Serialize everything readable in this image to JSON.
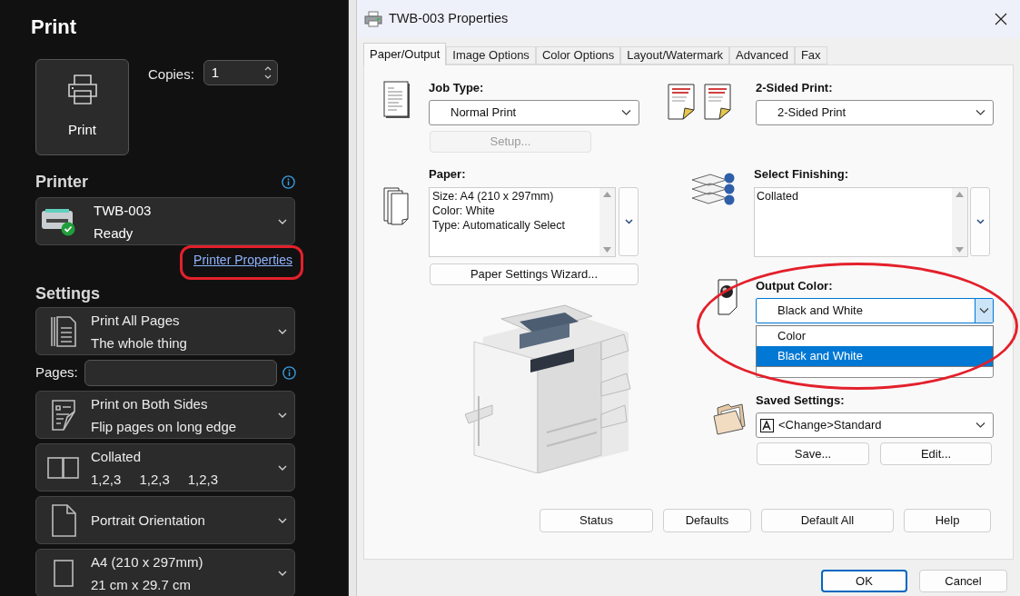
{
  "print_pane": {
    "title": "Print",
    "print_button": "Print",
    "copies": {
      "label": "Copies:",
      "value": "1"
    },
    "printer": {
      "heading": "Printer",
      "name": "TWB-003",
      "status": "Ready",
      "properties_link": "Printer Properties"
    },
    "settings": {
      "heading": "Settings",
      "items": [
        {
          "kind": "dropdown",
          "primary": "Print All Pages",
          "secondary": [
            "The whole thing"
          ]
        },
        {
          "kind": "field",
          "label": "Pages:"
        },
        {
          "kind": "dropdown",
          "primary": "Print on Both Sides",
          "secondary": [
            "Flip pages on long edge"
          ]
        },
        {
          "kind": "dropdown",
          "primary": "Collated",
          "secondary": [
            "1,2,3",
            "1,2,3",
            "1,2,3"
          ]
        },
        {
          "kind": "dropdown",
          "primary": "Portrait Orientation"
        },
        {
          "kind": "dropdown",
          "primary": "A4 (210 x 297mm)",
          "secondary": [
            "21 cm x 29.7 cm"
          ]
        }
      ]
    }
  },
  "dialog": {
    "title": "TWB-003 Properties",
    "tabs": [
      {
        "label": "Paper/Output",
        "selected": true
      },
      {
        "label": "Image Options",
        "selected": false
      },
      {
        "label": "Color Options",
        "selected": false
      },
      {
        "label": "Layout/Watermark",
        "selected": false
      },
      {
        "label": "Advanced",
        "selected": false
      },
      {
        "label": "Fax",
        "selected": false
      }
    ],
    "job_type": {
      "label": "Job Type:",
      "value": "Normal Print",
      "setup_button": {
        "label": "Setup...",
        "disabled": true
      }
    },
    "paper": {
      "label": "Paper:",
      "lines": [
        "Size: A4 (210 x 297mm)",
        "Color: White",
        "Type: Automatically Select"
      ],
      "wizard_button": "Paper Settings Wizard..."
    },
    "two_sided": {
      "label": "2-Sided Print:",
      "value": "2-Sided Print"
    },
    "finishing": {
      "label": "Select Finishing:",
      "lines": [
        "Collated"
      ]
    },
    "output_color": {
      "label": "Output Color:",
      "value": "Black and White",
      "expanded": true,
      "options": [
        {
          "label": "Color",
          "selected": false
        },
        {
          "label": "Black and White",
          "selected": true
        }
      ]
    },
    "saved_settings": {
      "label": "Saved Settings:",
      "value": "<Change>Standard",
      "buttons": [
        "Save...",
        "Edit..."
      ]
    },
    "panel_buttons": [
      "Status",
      "Defaults",
      "Default All",
      "Help"
    ],
    "footer_buttons": [
      {
        "label": "OK",
        "default": true
      },
      {
        "label": "Cancel",
        "default": false
      }
    ]
  }
}
